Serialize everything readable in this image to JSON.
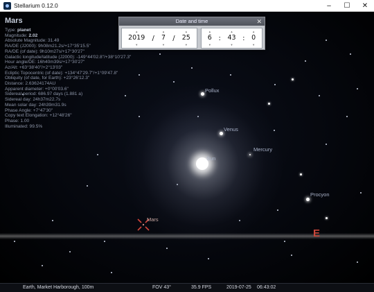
{
  "window": {
    "title": "Stellarium 0.12.0",
    "controls": [
      "–",
      "☐",
      "✕"
    ]
  },
  "info_panel": {
    "name": "Mars",
    "lines": [
      {
        "label": "Type: ",
        "value": "planet",
        "bold": true
      },
      {
        "label": "Magnitude: ",
        "value": "2.02",
        "bold": true
      },
      {
        "label": "",
        "value": "Absolute Magnitude: 31.49"
      },
      {
        "label": "",
        "value": "RA/DE (J2000): 9h08m21.2s/+17°35'15.5\""
      },
      {
        "label": "",
        "value": "RA/DE (of date): 9h10m27s/+17°30'27\""
      },
      {
        "label": "",
        "value": "Galactic longitude/latitude (J2000): -149°44'02.8\"/+38°10'27.3\""
      },
      {
        "label": "",
        "value": "Hour angle/DE: 16h40m39s/+17°30'27\""
      },
      {
        "label": "",
        "value": "Az/Alt: +63°38'40\"/+2°13'03\""
      },
      {
        "label": "",
        "value": "Ecliptic Topocentric (of date): +134°47'29.7\"/+1°09'47.8\""
      },
      {
        "label": "",
        "value": "Obliquity (of date, for Earth): +23°26'12.3\""
      },
      {
        "label": "",
        "value": "Distance: 2.63624174AU"
      },
      {
        "label": "",
        "value": "Apparent diameter: +0°00'03.6\""
      },
      {
        "label": "",
        "value": "Sidereal period: 686.97 days (1.881 a)"
      },
      {
        "label": "",
        "value": "Sidereal day: 24h37m22.7s"
      },
      {
        "label": "",
        "value": "Mean solar day: 24h39m31.9s"
      },
      {
        "label": "",
        "value": "Phase Angle: +7°47'30\""
      },
      {
        "label": "",
        "value": "Copy text Elongation: +12°48'26\""
      },
      {
        "label": "",
        "value": "Phase: 1.00"
      },
      {
        "label": "",
        "value": "Illuminated: 99.5%"
      }
    ]
  },
  "datetime_dialog": {
    "title": "Date and time",
    "close": "✕",
    "year": "2019",
    "month": "7",
    "day": "25",
    "hour": "6",
    "minute": "43",
    "second": "0",
    "date_sep": "/",
    "time_sep": ":"
  },
  "sky_labels": {
    "pollux": "Pollux",
    "venus": "Venus",
    "mercury": "Mercury",
    "sun": "Sun",
    "procyon": "Procyon",
    "mars": "Mars",
    "cardinal_east": "E"
  },
  "status_bar": {
    "location": "Earth, Market Harborough, 100m",
    "fov": "FOV 43°",
    "fps": "35.9 FPS",
    "date": "2019-07-25",
    "time": "06:43:02"
  },
  "colors": {
    "sky": "#05070d",
    "cardinal": "#c8463a",
    "mars_marker": "#d2443a",
    "dialog": "#c5c8cd"
  }
}
